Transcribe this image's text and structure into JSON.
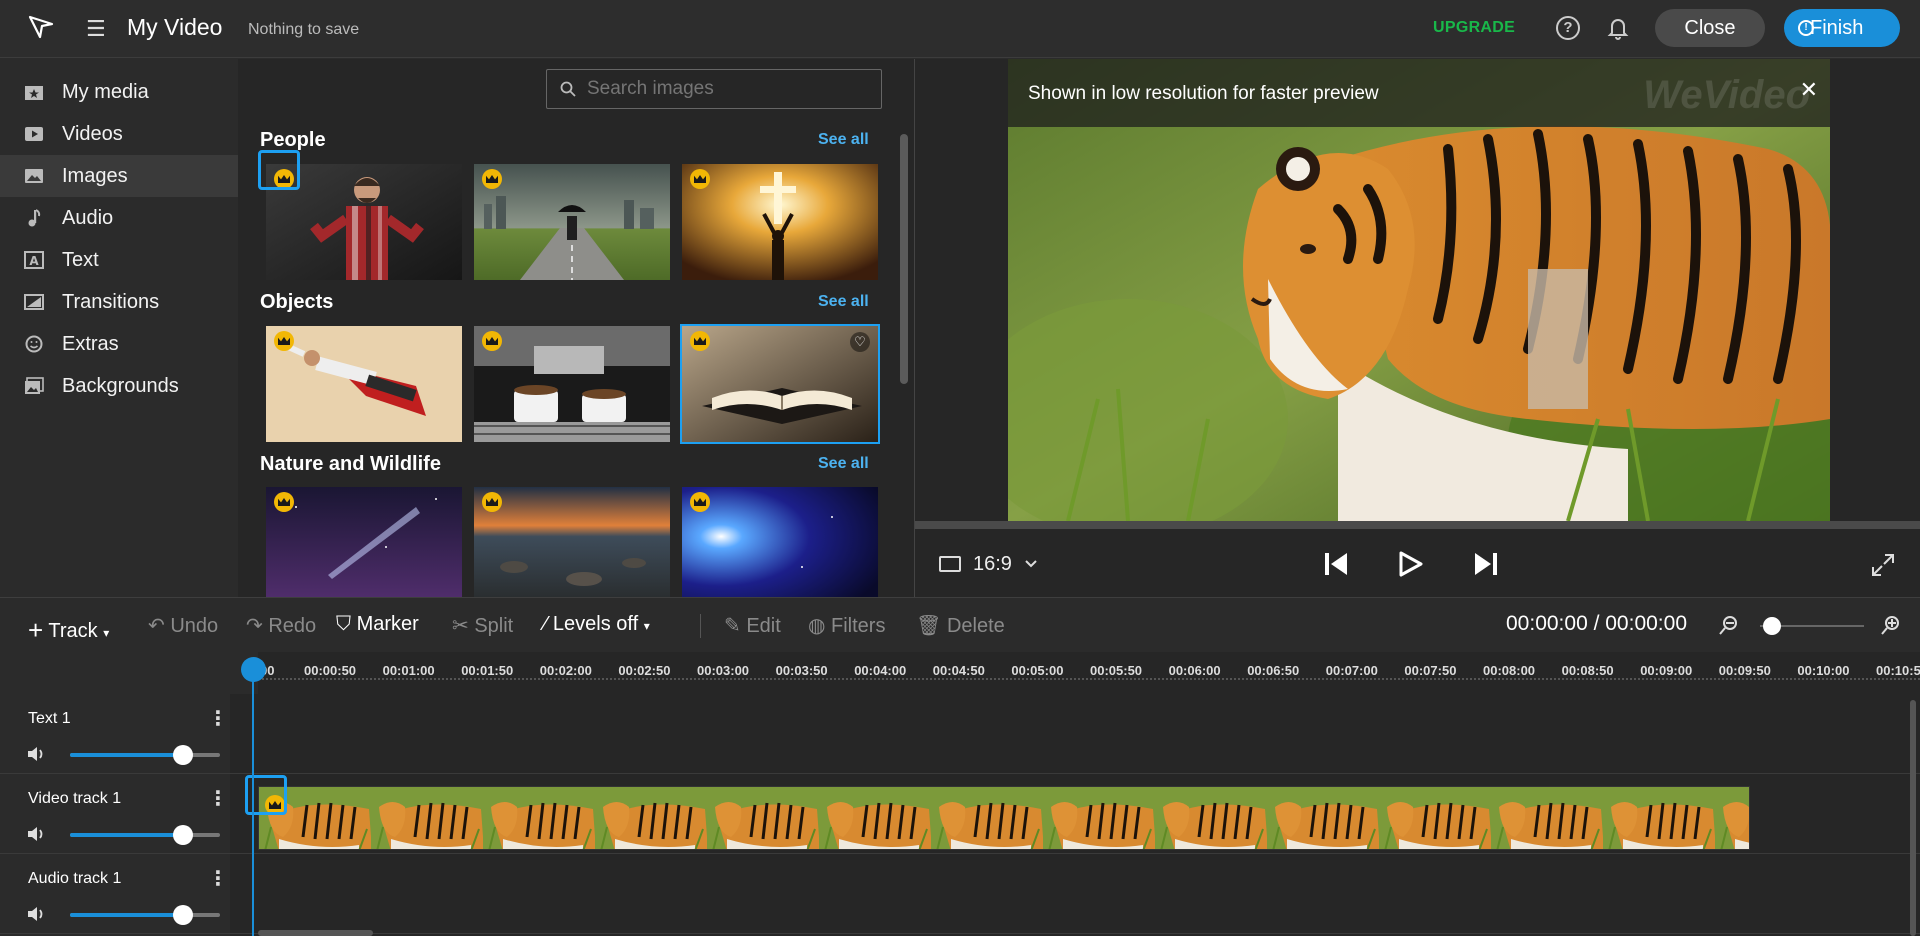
{
  "header": {
    "title": "My Video",
    "save_status": "Nothing to save",
    "upgrade_label": "UPGRADE",
    "close_label": "Close",
    "finish_label": "Finish"
  },
  "sidebar": {
    "items": [
      {
        "label": "My media",
        "icon": "my-media-icon"
      },
      {
        "label": "Videos",
        "icon": "video-icon"
      },
      {
        "label": "Images",
        "icon": "image-icon",
        "active": true
      },
      {
        "label": "Audio",
        "icon": "music-note-icon"
      },
      {
        "label": "Text",
        "icon": "text-icon"
      },
      {
        "label": "Transitions",
        "icon": "transition-icon"
      },
      {
        "label": "Extras",
        "icon": "smiley-icon"
      },
      {
        "label": "Backgrounds",
        "icon": "background-icon"
      }
    ]
  },
  "media": {
    "search_placeholder": "Search images",
    "see_all_label": "See all",
    "sections": [
      {
        "title": "People",
        "thumbs": [
          "shrugging man",
          "man with umbrella on road",
          "woman with cross in light"
        ]
      },
      {
        "title": "Objects",
        "thumbs": [
          "flying superhero",
          "espresso machine",
          "open book"
        ]
      },
      {
        "title": "Nature and Wildlife",
        "thumbs": [
          "night sky flashlight",
          "rocky beach sunset",
          "blue galaxy"
        ]
      }
    ]
  },
  "preview": {
    "banner_text": "Shown in low resolution for faster preview",
    "watermark": "WeVideo",
    "aspect_ratio": "16:9"
  },
  "toolbar": {
    "track": "Track",
    "undo": "Undo",
    "redo": "Redo",
    "marker": "Marker",
    "split": "Split",
    "levels": "Levels off",
    "edit": "Edit",
    "filters": "Filters",
    "delete": "Delete",
    "timecode": "00:00:00 / 00:00:00"
  },
  "ruler": {
    "ticks": [
      "00",
      "00:00:50",
      "00:01:00",
      "00:01:50",
      "00:02:00",
      "00:02:50",
      "00:03:00",
      "00:03:50",
      "00:04:00",
      "00:04:50",
      "00:05:00",
      "00:05:50",
      "00:06:00",
      "00:06:50",
      "00:07:00",
      "00:07:50",
      "00:08:00",
      "00:08:50",
      "00:09:00",
      "00:09:50",
      "00:10:00",
      "00:10:5"
    ]
  },
  "tracks": [
    {
      "name": "Text 1",
      "volume": 0.75
    },
    {
      "name": "Video track 1",
      "volume": 0.75
    },
    {
      "name": "Audio track 1",
      "volume": 0.75
    }
  ],
  "colors": {
    "accent": "#1a8fd9",
    "upgrade": "#19b84a",
    "premium_crown": "#f2b705"
  }
}
